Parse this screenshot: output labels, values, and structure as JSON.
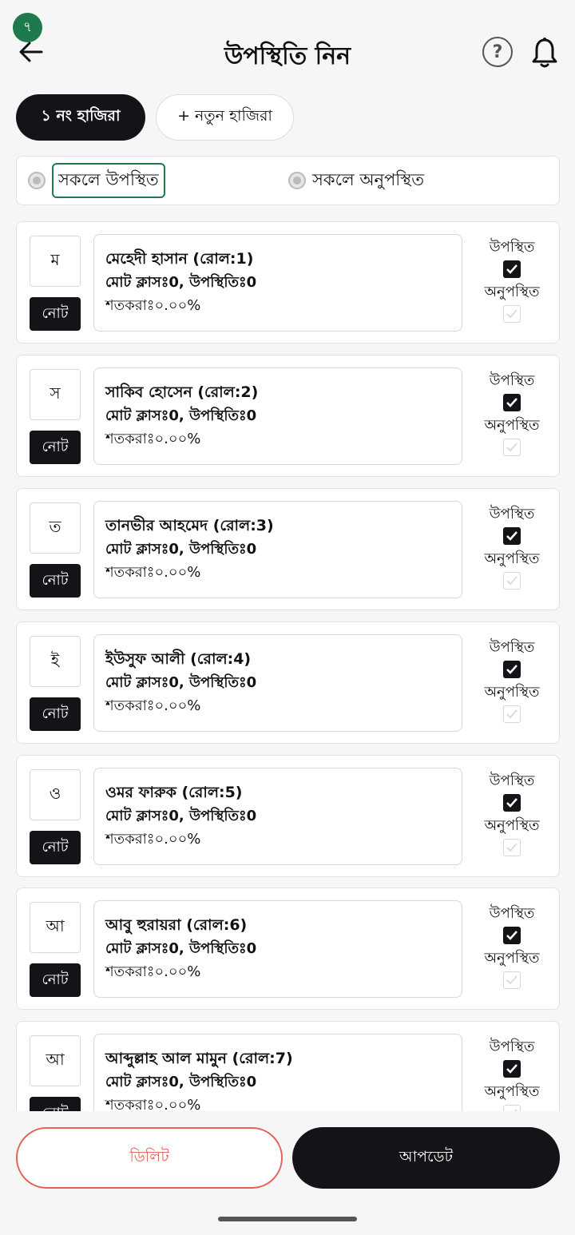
{
  "header": {
    "badge": "৭",
    "title": "উপস্থিতি নিন",
    "help_icon": "question-circle-icon",
    "bell_icon": "bell-icon",
    "back_icon": "arrow-left-icon"
  },
  "tabs": {
    "active": "১ নং হাজিরা",
    "new": "+ নতুন হাজিরা"
  },
  "bulk": {
    "all_present": "সকলে উপস্থিত",
    "all_absent": "সকলে অনুপস্থিত"
  },
  "labels": {
    "present": "উপস্থিত",
    "absent": "অনুপস্থিত",
    "note": "নোট"
  },
  "students": [
    {
      "initial": "ম",
      "name": "মেহেদী হাসান (রোল:1)",
      "stats": "মোট ক্লাসঃ0, উপস্থিতিঃ0",
      "percent": "শতকরাঃ০.০০%",
      "present": true,
      "absent": false
    },
    {
      "initial": "স",
      "name": "সাকিব হোসেন (রোল:2)",
      "stats": "মোট ক্লাসঃ0, উপস্থিতিঃ0",
      "percent": "শতকরাঃ০.০০%",
      "present": true,
      "absent": false
    },
    {
      "initial": "ত",
      "name": "তানভীর আহমেদ (রোল:3)",
      "stats": "মোট ক্লাসঃ0, উপস্থিতিঃ0",
      "percent": "শতকরাঃ০.০০%",
      "present": true,
      "absent": false
    },
    {
      "initial": "ই",
      "name": "ইউসুফ আলী (রোল:4)",
      "stats": "মোট ক্লাসঃ0, উপস্থিতিঃ0",
      "percent": "শতকরাঃ০.০০%",
      "present": true,
      "absent": false
    },
    {
      "initial": "ও",
      "name": "ওমর ফারুক (রোল:5)",
      "stats": "মোট ক্লাসঃ0, উপস্থিতিঃ0",
      "percent": "শতকরাঃ০.০০%",
      "present": true,
      "absent": false
    },
    {
      "initial": "আ",
      "name": "আবু হুরায়রা (রোল:6)",
      "stats": "মোট ক্লাসঃ0, উপস্থিতিঃ0",
      "percent": "শতকরাঃ০.০০%",
      "present": true,
      "absent": false
    },
    {
      "initial": "আ",
      "name": "আব্দুল্লাহ আল মামুন (রোল:7)",
      "stats": "মোট ক্লাসঃ0, উপস্থিতিঃ0",
      "percent": "শতকরাঃ০.০০%",
      "present": true,
      "absent": false
    }
  ],
  "footer": {
    "delete": "ডিলিট",
    "update": "আপডেট"
  },
  "colors": {
    "accent_green": "#1e7a4c",
    "dark": "#131417",
    "danger": "#e4625a"
  }
}
